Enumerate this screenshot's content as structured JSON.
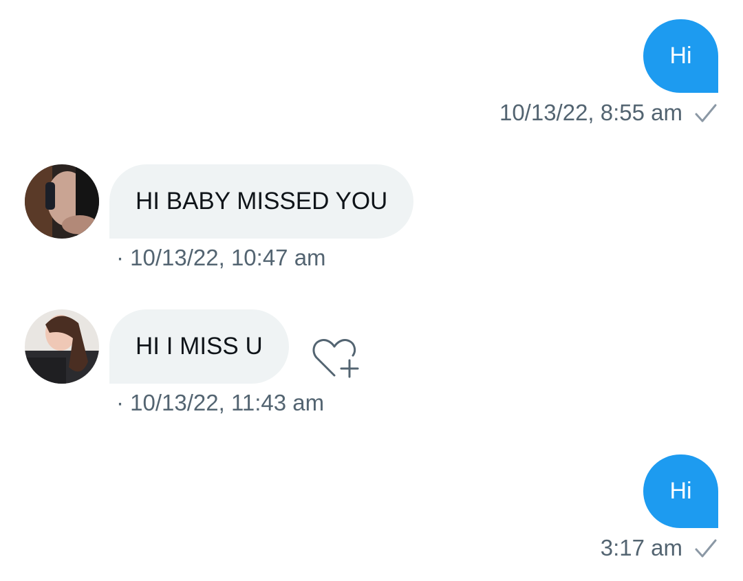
{
  "conversation": {
    "messages": [
      {
        "direction": "sent",
        "text": "Hi",
        "meta": "10/13/22, 8:55 am",
        "status_icon": "check-icon"
      },
      {
        "direction": "received",
        "text": "HI BABY MISSED YOU",
        "meta": "· 10/13/22, 10:47 am",
        "avatar_icon": "avatar-photo"
      },
      {
        "direction": "received",
        "text": "HI I MISS U",
        "meta": "· 10/13/22, 11:43 am",
        "avatar_icon": "avatar-photo",
        "action_icon": "heart-plus-icon"
      },
      {
        "direction": "sent",
        "text": "Hi",
        "meta": "3:17 am",
        "status_icon": "check-icon"
      }
    ]
  },
  "colors": {
    "sent_bubble": "#1d9bf0",
    "received_bubble": "#eff3f4",
    "meta_text": "#536471",
    "message_text": "#0f1419"
  }
}
